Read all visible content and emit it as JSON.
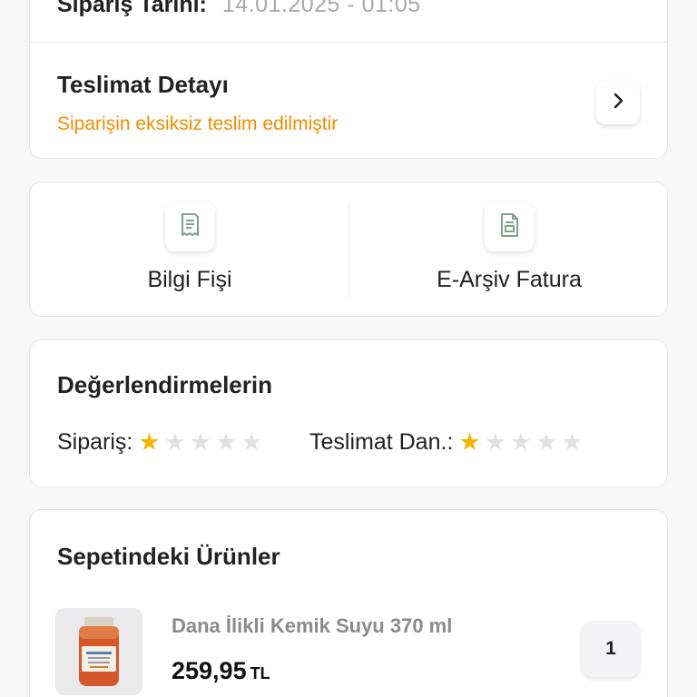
{
  "order": {
    "date_label": "Sipariş Tarihi:",
    "date_value": "14.01.2025 - 01:05"
  },
  "delivery": {
    "title": "Teslimat Detayı",
    "status": "Siparişin eksiksiz teslim edilmiştir",
    "status_color": "#f28c00",
    "chevron_icon": "chevron-right-icon"
  },
  "documents": {
    "items": [
      {
        "label": "Bilgi Fişi",
        "icon": "receipt-icon"
      },
      {
        "label": "E-Arşiv Fatura",
        "icon": "invoice-icon"
      }
    ]
  },
  "ratings": {
    "title": "Değerlendirmelerin",
    "order_label": "Sipariş:",
    "order_stars": 1,
    "delivery_label": "Teslimat Dan.:",
    "delivery_stars": 1,
    "max_stars": 5,
    "star_color": "#f5b400"
  },
  "basket": {
    "title": "Sepetindeki Ürünler",
    "items": [
      {
        "name": "Dana İlikli Kemik Suyu 370 ml",
        "price": "259,95",
        "currency": "TL",
        "quantity": "1"
      }
    ]
  }
}
